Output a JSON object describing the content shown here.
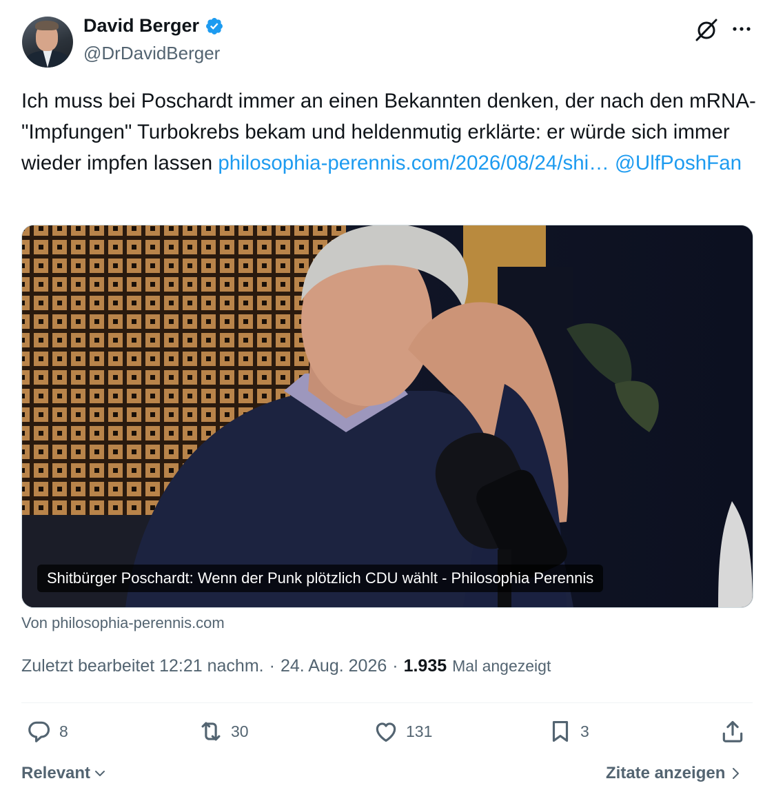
{
  "author": {
    "name": "David Berger",
    "handle": "@DrDavidBerger"
  },
  "header_icons": [
    "grok-icon",
    "more-icon"
  ],
  "tweet": {
    "text": "Ich muss bei Poschardt immer an einen Bekannten denken, der nach den mRNA-\"Impfungen\" Turbokrebs bekam und heldenmutig erklärte: er würde sich immer wieder impfen lassen ",
    "link_text": "philosophia-perennis.com/2026/08/24/shi…",
    "mention": "@UlfPoshFan"
  },
  "link_card": {
    "caption": "Shitbürger Poschardt: Wenn der Punk plötzlich CDU wählt - Philosophia Perennis",
    "source": "Von philosophia-perennis.com"
  },
  "meta": {
    "edited": "Zuletzt bearbeitet 12:21 nachm.",
    "separator": "·",
    "date": "24. Aug. 2026",
    "views_count": "1.935",
    "views_label": "Mal angezeigt"
  },
  "actions": {
    "replies": "8",
    "reposts": "30",
    "likes": "131",
    "bookmarks": "3"
  },
  "footer": {
    "sort_label": "Relevant",
    "quotes_label": "Zitate anzeigen"
  },
  "colors": {
    "link": "#1d9bf0",
    "secondary_text": "#536471",
    "primary_text": "#0f1419",
    "verified_badge": "#1d9bf0"
  }
}
